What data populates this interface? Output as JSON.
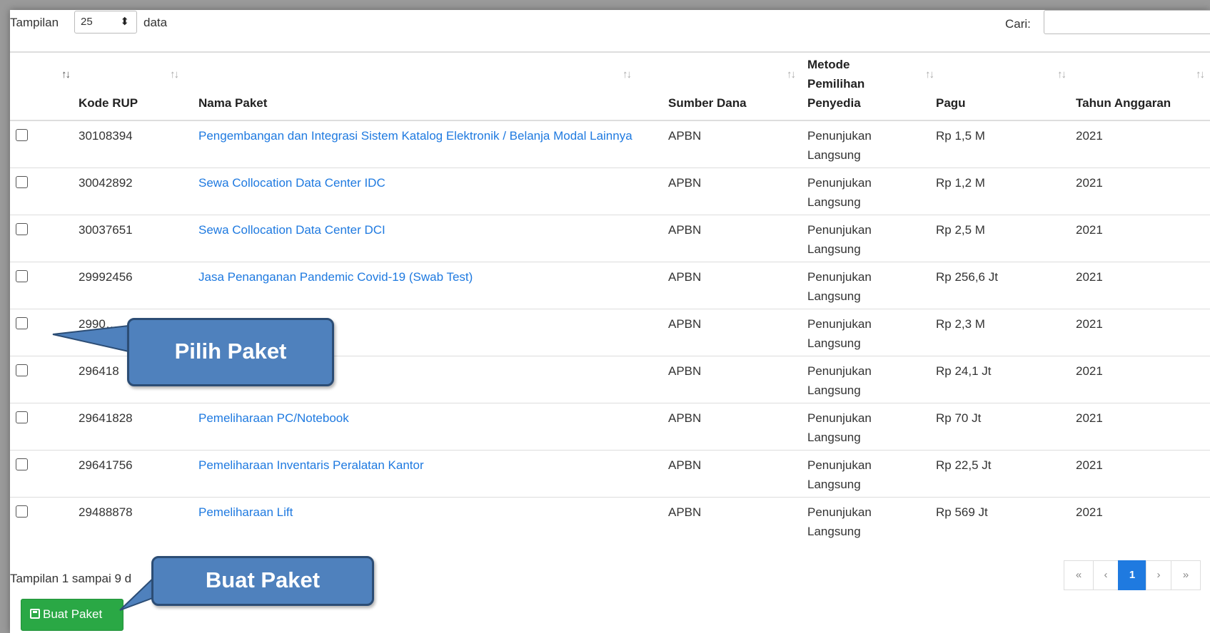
{
  "length_control": {
    "prefix": "Tampilan",
    "value": "25",
    "suffix": "data"
  },
  "search": {
    "label": "Cari:",
    "value": ""
  },
  "columns": [
    {
      "key": "kode",
      "label": "Kode RUP"
    },
    {
      "key": "nama",
      "label": "Nama Paket"
    },
    {
      "key": "sumber",
      "label": "Sumber Dana"
    },
    {
      "key": "metode",
      "label": "Metode Pemilihan Penyedia"
    },
    {
      "key": "pagu",
      "label": "Pagu"
    },
    {
      "key": "tahun",
      "label": "Tahun Anggaran"
    }
  ],
  "rows": [
    {
      "kode": "30108394",
      "nama": "Pengembangan dan Integrasi Sistem Katalog Elektronik / Belanja Modal Lainnya",
      "sumber": "APBN",
      "metode": "Penunjukan Langsung",
      "pagu": "Rp 1,5 M",
      "tahun": "2021"
    },
    {
      "kode": "30042892",
      "nama": "Sewa Collocation Data Center IDC",
      "sumber": "APBN",
      "metode": "Penunjukan Langsung",
      "pagu": "Rp 1,2 M",
      "tahun": "2021"
    },
    {
      "kode": "30037651",
      "nama": "Sewa Collocation Data Center DCI",
      "sumber": "APBN",
      "metode": "Penunjukan Langsung",
      "pagu": "Rp 2,5 M",
      "tahun": "2021"
    },
    {
      "kode": "29992456",
      "nama": "Jasa Penanganan Pandemic Covid-19 (Swab Test)",
      "sumber": "APBN",
      "metode": "Penunjukan Langsung",
      "pagu": "Rp 256,6 Jt",
      "tahun": "2021"
    },
    {
      "kode": "2990…",
      "nama": "",
      "sumber": "APBN",
      "metode": "Penunjukan Langsung",
      "pagu": "Rp 2,3 M",
      "tahun": "2021"
    },
    {
      "kode": "296418",
      "nama": "",
      "sumber": "APBN",
      "metode": "Penunjukan Langsung",
      "pagu": "Rp 24,1 Jt",
      "tahun": "2021"
    },
    {
      "kode": "29641828",
      "nama": "Pemeliharaan PC/Notebook",
      "sumber": "APBN",
      "metode": "Penunjukan Langsung",
      "pagu": "Rp 70 Jt",
      "tahun": "2021"
    },
    {
      "kode": "29641756",
      "nama": "Pemeliharaan Inventaris Peralatan Kantor",
      "sumber": "APBN",
      "metode": "Penunjukan Langsung",
      "pagu": "Rp 22,5 Jt",
      "tahun": "2021"
    },
    {
      "kode": "29488878",
      "nama": "Pemeliharaan Lift",
      "sumber": "APBN",
      "metode": "Penunjukan Langsung",
      "pagu": "Rp 569 Jt",
      "tahun": "2021"
    }
  ],
  "info": "Tampilan 1 sampai 9 d",
  "pagination": {
    "first": "«",
    "prev": "‹",
    "current": "1",
    "next": "›",
    "last": "»"
  },
  "buat_button": "Buat Paket",
  "callouts": {
    "pilih": "Pilih Paket",
    "buat": "Buat Paket"
  },
  "colors": {
    "link": "#1f7ae0",
    "button_green": "#2aa845",
    "callout_fill": "#4f81bd",
    "callout_border": "#2c4d75"
  }
}
